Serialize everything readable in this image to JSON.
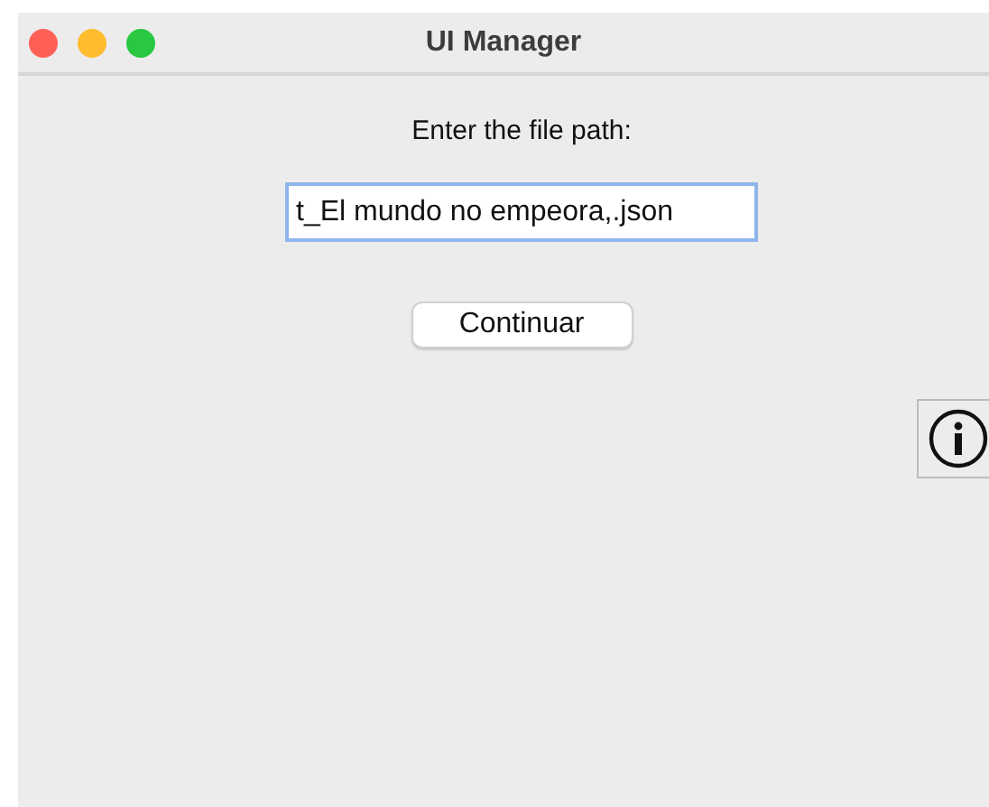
{
  "window": {
    "title": "UI Manager"
  },
  "prompt": "Enter the file path:",
  "path_field": {
    "value": "t_El mundo no empeora,.json",
    "focused": true
  },
  "continue_button": {
    "label": "Continuar"
  }
}
